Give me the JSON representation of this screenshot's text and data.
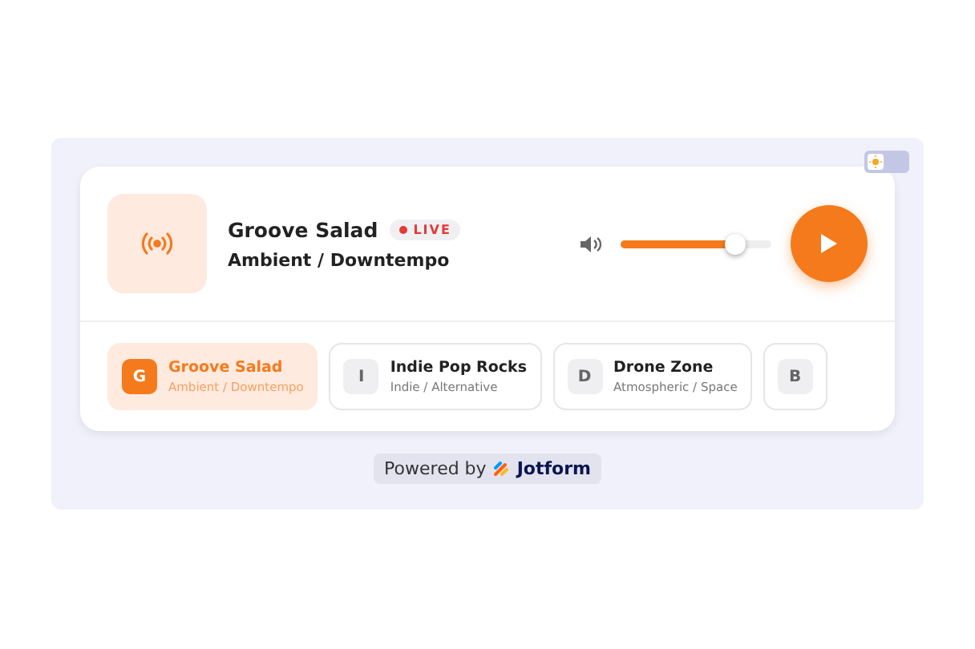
{
  "now_playing": {
    "title": "Groove Salad",
    "badge": "LIVE",
    "genre": "Ambient / Downtempo"
  },
  "volume": {
    "level": 0.75
  },
  "play_button": {
    "playing": false
  },
  "theme_toggle": {
    "dark": false
  },
  "stations": [
    {
      "initial": "G",
      "name": "Groove Salad",
      "genre": "Ambient / Downtempo",
      "selected": true
    },
    {
      "initial": "I",
      "name": "Indie Pop Rocks",
      "genre": "Indie / Alternative",
      "selected": false
    },
    {
      "initial": "D",
      "name": "Drone Zone",
      "genre": "Atmospheric / Space",
      "selected": false
    },
    {
      "initial": "B",
      "selected": false
    }
  ],
  "footer": {
    "prefix": "Powered by",
    "brand": "Jotform"
  }
}
